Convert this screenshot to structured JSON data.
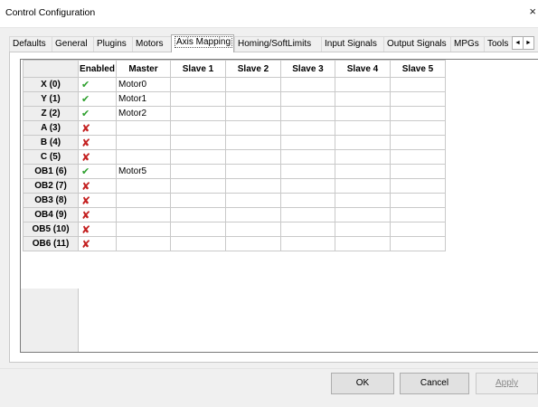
{
  "window": {
    "title": "Control Configuration",
    "close_glyph": "×"
  },
  "tabs": [
    {
      "label": "Defaults"
    },
    {
      "label": "General"
    },
    {
      "label": "Plugins"
    },
    {
      "label": "Motors"
    },
    {
      "label": "Axis Mapping",
      "active": true
    },
    {
      "label": "Homing/SoftLimits"
    },
    {
      "label": "Input Signals"
    },
    {
      "label": "Output Signals"
    },
    {
      "label": "MPGs"
    },
    {
      "label": "Tools"
    }
  ],
  "tab_scroll": {
    "left": "◄",
    "right": "►"
  },
  "grid": {
    "columns": [
      "Enabled",
      "Master",
      "Slave 1",
      "Slave 2",
      "Slave 3",
      "Slave 4",
      "Slave 5"
    ],
    "rows": [
      {
        "axis": "X (0)",
        "enabled": true,
        "master": "Motor0"
      },
      {
        "axis": "Y (1)",
        "enabled": true,
        "master": "Motor1"
      },
      {
        "axis": "Z (2)",
        "enabled": true,
        "master": "Motor2"
      },
      {
        "axis": "A (3)",
        "enabled": false,
        "master": ""
      },
      {
        "axis": "B (4)",
        "enabled": false,
        "master": ""
      },
      {
        "axis": "C (5)",
        "enabled": false,
        "master": ""
      },
      {
        "axis": "OB1 (6)",
        "enabled": true,
        "master": "Motor5"
      },
      {
        "axis": "OB2 (7)",
        "enabled": false,
        "master": ""
      },
      {
        "axis": "OB3 (8)",
        "enabled": false,
        "master": ""
      },
      {
        "axis": "OB4 (9)",
        "enabled": false,
        "master": ""
      },
      {
        "axis": "OB5 (10)",
        "enabled": false,
        "master": ""
      },
      {
        "axis": "OB6 (11)",
        "enabled": false,
        "master": ""
      }
    ],
    "enabled_icon": "check-icon",
    "disabled_icon": "cross-icon",
    "colors": {
      "check": "#2da02d",
      "cross": "#c42020"
    }
  },
  "buttons": {
    "ok": "OK",
    "cancel": "Cancel",
    "apply": "Apply"
  }
}
